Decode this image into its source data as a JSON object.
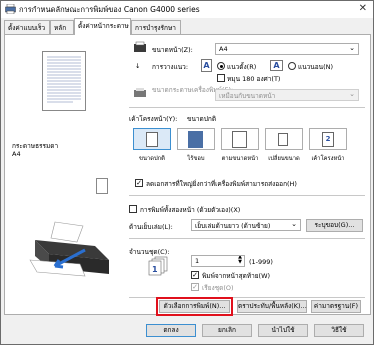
{
  "window": {
    "title": "การกำหนดลักษณะการพิมพ์ของ Canon G4000 series",
    "close_glyph": "✕"
  },
  "tabs": [
    {
      "label": "ตั้งค่าแบบเร็ว"
    },
    {
      "label": "หลัก"
    },
    {
      "label": "ตั้งค่าหน้ากระดาษ"
    },
    {
      "label": "การบำรุงรักษา"
    }
  ],
  "preview": {
    "media_label": "กระดาษธรรมดา",
    "size_label": "A4"
  },
  "page_size": {
    "label": "ขนาดหน้า(Z):",
    "value": "A4"
  },
  "orientation": {
    "label": "การวางแนว:",
    "portrait": "แนวตั้ง(R)",
    "landscape": "แนวนอน(N)",
    "rotate": "หมุน 180 องศา(T)"
  },
  "printer_paper_size": {
    "label": "ขนาดกระดาษเครื่องพิมพ์(E):",
    "value": "เหมือนกับขนาดหน้า"
  },
  "layout": {
    "label": "เค้าโครงหน้า(Y):",
    "value": "ขนาดปกติ",
    "options": [
      "ขนาดปกติ",
      "ไร้ขอบ",
      "ตามขนาดหน้า",
      "เปลี่ยนขนาด",
      "เค้าโครงหน้า"
    ],
    "icon_number": "2"
  },
  "auto_reduce": {
    "label": "ลดเอกสารที่ใหญ่ยิ่งกว่าที่เครื่องพิมพ์สามารถส่งออก(H)"
  },
  "duplex": {
    "label": "การพิมพ์ทั้งสองหน้า (ด้วยตัวเอง)(X)"
  },
  "stapling": {
    "label": "ด้านเย็บเล่ม(L):",
    "value": "เย็บเล่มด้านยาว (ด้านซ้าย)",
    "button": "ระบุขอบ(G)..."
  },
  "copies": {
    "label": "จำนวนชุด(C):",
    "value": "1",
    "range": "(1-999)",
    "last_page_first": "พิมพ์จากหน้าสุดท้าย(W)",
    "collate": "เรียงชุด(O)"
  },
  "bottom_buttons": {
    "print_options": "ตัวเลือกการพิมพ์(N)...",
    "stamp": "ตราประทับ/พื้นหลัง(K)...",
    "defaults": "ค่ามาตรฐาน(F)"
  },
  "dialog_buttons": {
    "ok": "ตกลง",
    "cancel": "ยกเลิก",
    "apply": "นำไปใช้",
    "help": "วิธีใช้"
  },
  "colors": {
    "highlight": "#e0101c",
    "selection": "#3c8fd0"
  }
}
